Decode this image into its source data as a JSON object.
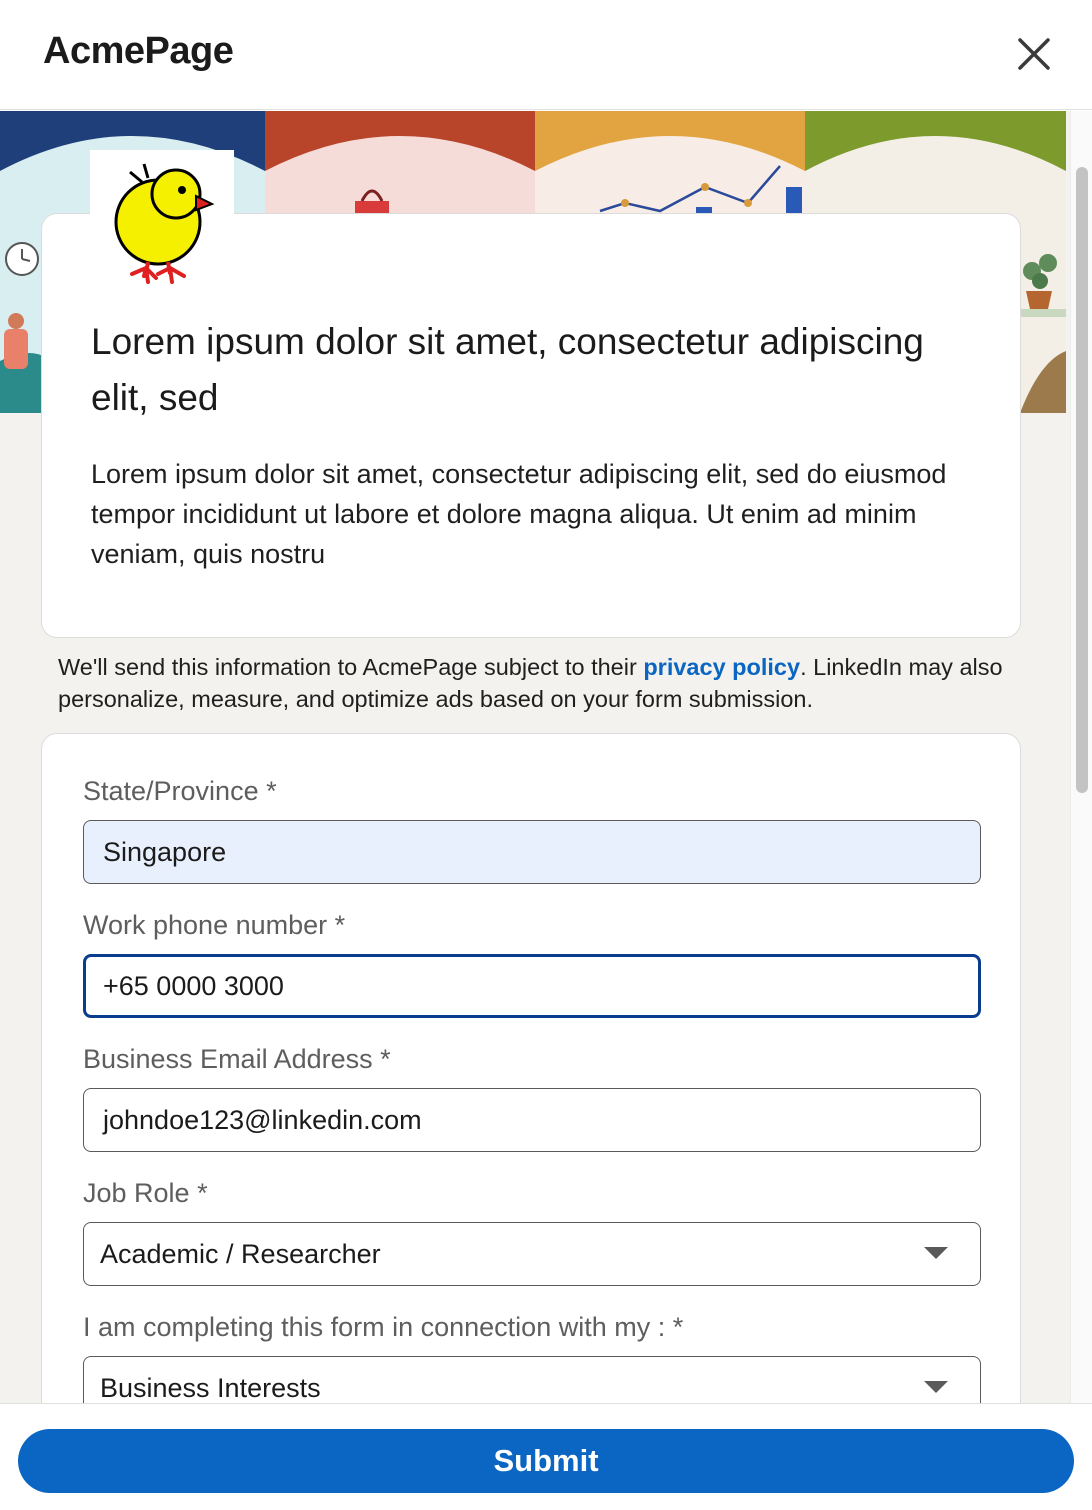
{
  "header": {
    "app_title": "AcmePage",
    "close_icon": "close-icon"
  },
  "info_card": {
    "title": "Lorem ipsum dolor sit amet, consectetur adipiscing elit, sed",
    "description": "Lorem ipsum dolor sit amet, consectetur adipiscing elit, sed do eiusmod tempor incididunt ut labore et dolore magna aliqua. Ut enim ad minim veniam, quis nostru"
  },
  "notice": {
    "before_link": "We'll send this information to AcmePage subject to their ",
    "link_text": "privacy policy",
    "after_link": ". LinkedIn may also personalize, measure, and optimize ads based on your form submission."
  },
  "form": {
    "fields": [
      {
        "label": "State/Province *",
        "value": "Singapore"
      },
      {
        "label": "Work phone number *",
        "value": "+65 0000 3000"
      },
      {
        "label": "Business Email Address *",
        "value": "johndoe123@linkedin.com"
      },
      {
        "label": "Job Role *",
        "value": "Academic / Researcher"
      },
      {
        "label": "I am completing this form in connection with my : *",
        "value": "Business Interests"
      }
    ]
  },
  "footer": {
    "submit_label": "Submit"
  },
  "colors": {
    "accent": "#0a66c2",
    "autofill_bg": "#e8effd",
    "focus_border": "#0a3d8f"
  }
}
